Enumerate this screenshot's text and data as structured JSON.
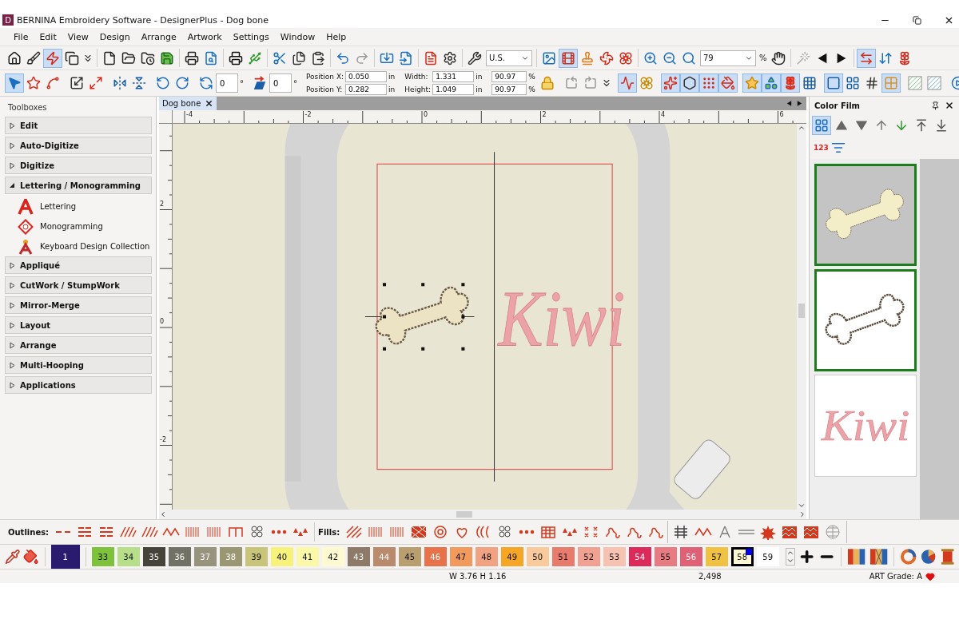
{
  "window": {
    "logo": "D",
    "title": "BERNINA Embroidery Software - DesignerPlus - Dog bone"
  },
  "menu": [
    "File",
    "Edit",
    "View",
    "Design",
    "Arrange",
    "Artwork",
    "Settings",
    "Window",
    "Help"
  ],
  "toolbar_1": {
    "buttons": [
      {
        "selected": false
      },
      {
        "selected": false
      },
      {
        "selected": true
      },
      {
        "selected": false
      },
      {
        "selected": false
      },
      {
        "selected": false
      },
      {
        "selected": false
      },
      {
        "selected": false
      },
      {
        "selected": false
      },
      {
        "selected": false
      },
      {
        "selected": false
      },
      {
        "selected": false
      },
      {
        "selected": false
      },
      {
        "selected": false
      },
      {
        "selected": false
      },
      {
        "selected": false
      },
      {
        "selected": false
      },
      {
        "selected": false
      },
      {
        "selected": false
      },
      {
        "selected": false
      },
      {
        "selected": false
      },
      {
        "selected": false
      },
      {
        "selected": false
      },
      {
        "selected": false
      },
      {
        "selected": true
      },
      {
        "selected": false
      },
      {
        "selected": false
      },
      {
        "selected": false
      },
      {
        "selected": false
      },
      {
        "selected": false
      },
      {
        "selected": false
      },
      {
        "selected": false
      },
      {
        "selected": false
      },
      {
        "selected": false
      },
      {
        "selected": false
      },
      {
        "selected": true
      },
      {
        "selected": false
      },
      {
        "selected": false
      }
    ],
    "units": "U.S.",
    "zoom": "79",
    "zoom_unit": "%"
  },
  "toolbar_2": {
    "buttons": [
      {
        "selected": true
      },
      {
        "selected": false
      },
      {
        "selected": false
      },
      {
        "selected": false
      },
      {
        "selected": false
      },
      {
        "selected": false
      },
      {
        "selected": false
      },
      {
        "selected": false
      },
      {
        "selected": false
      },
      {
        "selected": false
      },
      {
        "selected": false
      },
      {
        "selected": false
      },
      {
        "selected": false
      },
      {
        "selected": false
      },
      {
        "selected": false
      },
      {
        "selected": true
      },
      {
        "selected": false
      },
      {
        "selected": true
      },
      {
        "selected": true
      },
      {
        "selected": true
      },
      {
        "selected": true
      },
      {
        "selected": true
      },
      {
        "selected": true
      },
      {
        "selected": true
      },
      {
        "selected": false
      },
      {
        "selected": true
      },
      {
        "selected": false
      },
      {
        "selected": false
      },
      {
        "selected": true
      },
      {
        "selected": false
      },
      {
        "selected": false
      },
      {
        "selected": false
      }
    ]
  },
  "transform": {
    "rotation": {
      "value": "0",
      "unit": "°"
    },
    "slant": {
      "value": "0",
      "unit": "°"
    },
    "position": [
      {
        "label": "Position X:",
        "value": "0.050",
        "unit": "in"
      },
      {
        "label": "Position Y:",
        "value": "0.282",
        "unit": "in"
      }
    ],
    "size": [
      {
        "label": "Width:",
        "value": "1.331",
        "unit": "in"
      },
      {
        "label": "Height:",
        "value": "1.049",
        "unit": "in"
      }
    ],
    "scale": [
      {
        "value": "90.97",
        "unit": "%"
      },
      {
        "value": "90.97",
        "unit": "%"
      }
    ]
  },
  "toolboxes": {
    "title": "Toolboxes",
    "sections": [
      {
        "label": "Edit",
        "expanded": false
      },
      {
        "label": "Auto-Digitize",
        "expanded": false
      },
      {
        "label": "Digitize",
        "expanded": false
      },
      {
        "label": "Lettering / Monogramming",
        "expanded": true,
        "children": [
          {
            "kind": "lettering",
            "label": "Lettering"
          },
          {
            "kind": "monogram",
            "label": "Monogramming"
          },
          {
            "kind": "keyboard",
            "label": "Keyboard Design Collection"
          }
        ]
      },
      {
        "label": "Appliqué",
        "expanded": false
      },
      {
        "label": "CutWork / StumpWork",
        "expanded": false
      },
      {
        "label": "Mirror-Merge",
        "expanded": false
      },
      {
        "label": "Layout",
        "expanded": false
      },
      {
        "label": "Arrange",
        "expanded": false
      },
      {
        "label": "Multi-Hooping",
        "expanded": false
      },
      {
        "label": "Applications",
        "expanded": false
      }
    ]
  },
  "document": {
    "tab": "Dog bone",
    "ruler_horizontal": [
      "-4",
      "-2",
      "0",
      "2",
      "4",
      "6"
    ],
    "ruler_vertical": [
      "2",
      "0",
      "-2"
    ],
    "lettering": "Kiwi"
  },
  "color_film": {
    "title": "Color Film",
    "tools": [
      {
        "selected": true
      },
      {
        "selected": false
      },
      {
        "selected": false
      },
      {
        "selected": false
      },
      {
        "selected": false
      },
      {
        "selected": false
      },
      {
        "selected": false
      }
    ],
    "order_label": "123",
    "thumbnails": [
      {
        "kind": "bone-fill",
        "selected": true
      },
      {
        "kind": "bone-outline",
        "selected": true
      },
      {
        "kind": "lettering",
        "text": "Kiwi",
        "selected": false
      }
    ]
  },
  "stitch_bar": {
    "outlines_label": "Outlines:",
    "fills_label": "Fills:"
  },
  "palette": {
    "swatches": [
      {
        "label": "1",
        "color": "#2b1b6e",
        "selected": false
      },
      {
        "label": "33",
        "color": "#7dc23a",
        "selected": false
      },
      {
        "label": "34",
        "color": "#b7de89",
        "selected": false
      },
      {
        "label": "35",
        "color": "#46443a",
        "selected": false
      },
      {
        "label": "36",
        "color": "#727165",
        "selected": false
      },
      {
        "label": "37",
        "color": "#98937c",
        "selected": false
      },
      {
        "label": "38",
        "color": "#9b9773",
        "selected": false
      },
      {
        "label": "39",
        "color": "#c8c47a",
        "selected": false
      },
      {
        "label": "40",
        "color": "#f7f37a",
        "selected": false
      },
      {
        "label": "41",
        "color": "#fbf8a8",
        "selected": false
      },
      {
        "label": "42",
        "color": "#fdfad2",
        "selected": false
      },
      {
        "label": "43",
        "color": "#8e7a68",
        "selected": false
      },
      {
        "label": "44",
        "color": "#b98a6b",
        "selected": false
      },
      {
        "label": "45",
        "color": "#b99f6f",
        "selected": false
      },
      {
        "label": "46",
        "color": "#e8724a",
        "selected": false
      },
      {
        "label": "47",
        "color": "#f29a5c",
        "selected": false
      },
      {
        "label": "48",
        "color": "#f1a282",
        "selected": false
      },
      {
        "label": "49",
        "color": "#f6a624",
        "selected": false
      },
      {
        "label": "50",
        "color": "#f8ca9c",
        "selected": false
      },
      {
        "label": "51",
        "color": "#e87b6b",
        "selected": false
      },
      {
        "label": "52",
        "color": "#f0a192",
        "selected": false
      },
      {
        "label": "53",
        "color": "#f6c2b2",
        "selected": false
      },
      {
        "label": "54",
        "color": "#dc2b5b",
        "selected": false
      },
      {
        "label": "55",
        "color": "#e87b81",
        "selected": false
      },
      {
        "label": "56",
        "color": "#e06176",
        "selected": false
      },
      {
        "label": "57",
        "color": "#f1c242",
        "selected": false
      },
      {
        "label": "58",
        "color": "#fdf6d2",
        "selected": true
      },
      {
        "label": "59",
        "color": "#ffffff",
        "selected": false
      }
    ]
  },
  "status_bar": {
    "size": "W 3.76 H 1.16",
    "stitches": "2,498",
    "grade": "ART Grade: A"
  }
}
